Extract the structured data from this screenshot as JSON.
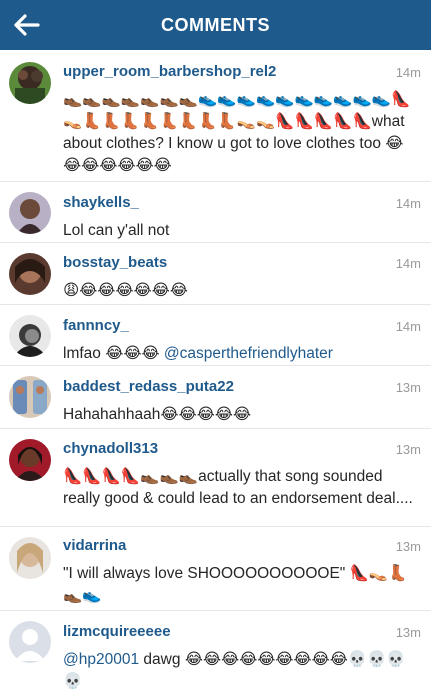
{
  "header": {
    "title": "COMMENTS",
    "back_icon": "back-arrow-icon"
  },
  "colors": {
    "header_bg": "#1f5a8c",
    "username": "#1f5a8c",
    "timestamp": "#9a9a9a",
    "text": "#262626"
  },
  "comments": [
    {
      "username": "upper_room_barbershop_rel2",
      "time": "14m",
      "text": "👞👞👞👞👞👞👞👟👟👟👟👟👟👟👟👟👟👠👡👢👢👢👢👢👢👢👢👡👡👠👠👠👠👠what about clothes? I know u got to love clothes too 😂😂😂😂😂😂😂"
    },
    {
      "username": "shaykells_",
      "time": "14m",
      "text": "Lol can y'all not"
    },
    {
      "username": "bosstay_beats",
      "time": "14m",
      "text": "😩😂😂😂😂😂😂"
    },
    {
      "username": "fannncy_",
      "time": "14m",
      "text": "lmfao 😂😂😂 ",
      "mention": "@casperthefriendlyhater"
    },
    {
      "username": "baddest_redass_puta22",
      "time": "13m",
      "text": "Hahahahhaah😂😂😂😂😂"
    },
    {
      "username": "chynadoll313",
      "time": "13m",
      "text": "👠👠👠👠👞👞👞actually that song sounded really good & could lead to an endorsement deal...."
    },
    {
      "username": "vidarrina",
      "time": "13m",
      "text": "\"I will always love SHOOOOOOOOOOE\" 👠👡👢👞👟"
    },
    {
      "username": "lizmcquireeeee",
      "time": "13m",
      "mention": "@hp20001",
      "text": " dawg 😂😂😂😂😂😂😂😂😂💀💀💀💀"
    }
  ]
}
